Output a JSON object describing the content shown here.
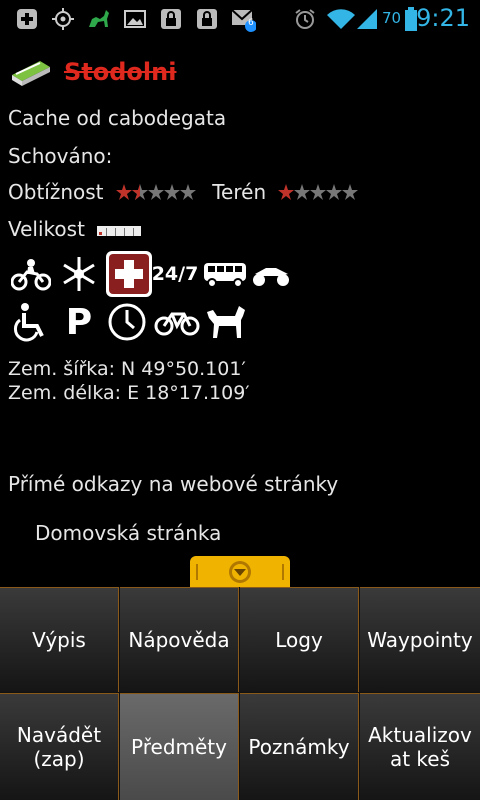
{
  "status": {
    "time": "9:21",
    "battery": "70",
    "mail_badge": "6",
    "icons": [
      "add-icon",
      "gps-icon",
      "animal-icon",
      "image-icon",
      "lock-icon",
      "lock-icon",
      "mail-icon",
      "alarm-icon",
      "wifi-icon",
      "signal-icon",
      "battery-icon"
    ]
  },
  "cache": {
    "title": "Stodolni",
    "owner_line": "Cache od cabodegata",
    "hidden_label": "Schováno:",
    "difficulty_label": "Obtížnost",
    "difficulty": 1.5,
    "terrain_label": "Terén",
    "terrain": 1,
    "size_label": "Velikost",
    "lat_line": "Zem. šířka: N 49°50.101′",
    "lon_line": "Zem. délka: E 18°17.109′",
    "links_heading": "Přímé odkazy na webové stránky",
    "home_link": "Domovská stránka",
    "attributes": [
      "motorcycle-icon",
      "snowflake-icon",
      "first-aid-icon",
      "24-7-icon",
      "bus-icon",
      "atv-icon",
      "wheelchair-icon",
      "parking-icon",
      "clock-icon",
      "bicycle-icon",
      "dog-icon"
    ],
    "attr_247_text": "24/7",
    "attr_parking_text": "P"
  },
  "menu": {
    "items": [
      {
        "label": "Výpis"
      },
      {
        "label": "Nápověda"
      },
      {
        "label": "Logy"
      },
      {
        "label": "Waypointy"
      },
      {
        "label": "Navádět (zap)"
      },
      {
        "label": "Předměty"
      },
      {
        "label": "Poznámky"
      },
      {
        "label": "Aktualizovat keš"
      }
    ]
  }
}
